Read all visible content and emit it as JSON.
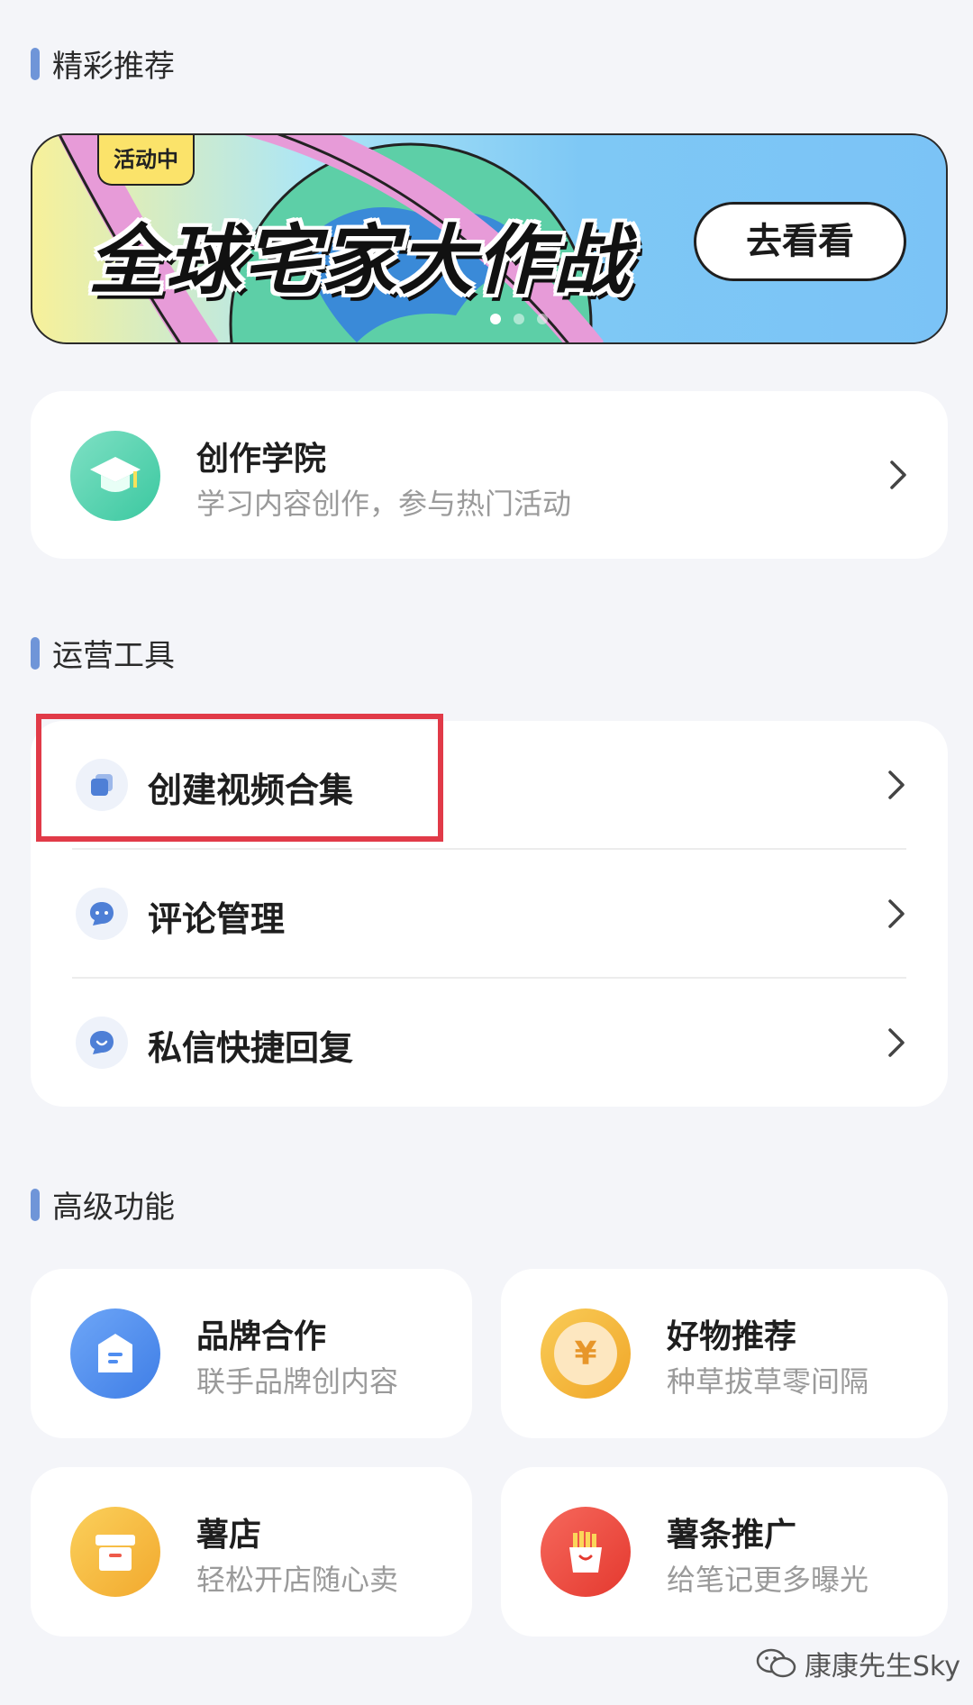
{
  "sections": {
    "featured": "精彩推荐",
    "tools": "运营工具",
    "advanced": "高级功能"
  },
  "banner": {
    "badge": "活动中",
    "headline": "全球宅家大作战",
    "cta": "去看看",
    "slide_count": 3,
    "active_slide": 1
  },
  "academy": {
    "title": "创作学院",
    "subtitle": "学习内容创作，参与热门活动",
    "icon": "graduation-cap-icon"
  },
  "tools": [
    {
      "label": "创建视频合集",
      "icon": "collection-icon"
    },
    {
      "label": "评论管理",
      "icon": "comment-icon"
    },
    {
      "label": "私信快捷回复",
      "icon": "message-icon"
    }
  ],
  "advanced": [
    {
      "title": "品牌合作",
      "subtitle": "联手品牌创内容",
      "icon": "brand-icon",
      "color": "#4f8df0"
    },
    {
      "title": "好物推荐",
      "subtitle": "种草拔草零间隔",
      "icon": "yen-coin-icon",
      "color": "#f5b43a"
    },
    {
      "title": "薯店",
      "subtitle": "轻松开店随心卖",
      "icon": "shop-box-icon",
      "color": "#f6b53b"
    },
    {
      "title": "薯条推广",
      "subtitle": "给笔记更多曝光",
      "icon": "fries-icon",
      "color": "#ee4b43"
    }
  ],
  "watermark": "康康先生Sky"
}
